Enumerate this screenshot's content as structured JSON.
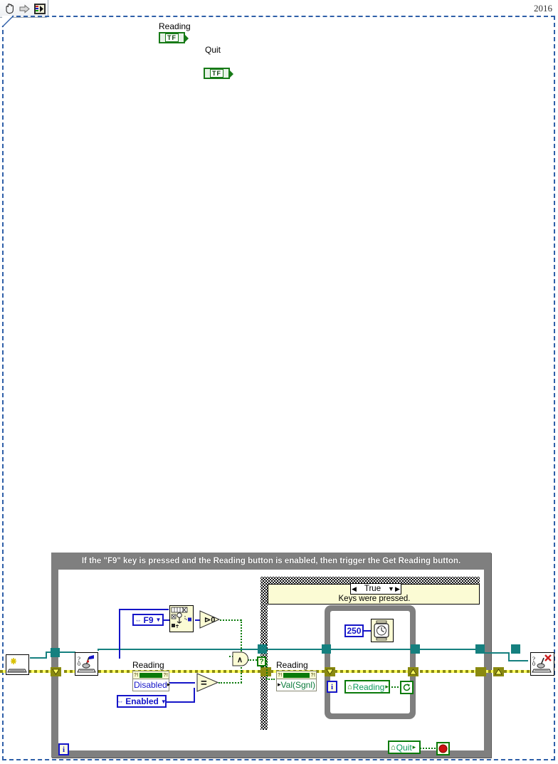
{
  "app": {
    "version_label": "2016"
  },
  "toolbar": {
    "buttons": [
      {
        "name": "hand-tool",
        "icon": "hand-icon",
        "label": "Hand tool"
      },
      {
        "name": "run-arrow",
        "icon": "arrow-right-icon",
        "label": "Run"
      },
      {
        "name": "connector-pane",
        "icon": "connector-pane-icon",
        "label": "Connector pane"
      }
    ]
  },
  "terminals": {
    "reading": {
      "label": "Reading",
      "value": "TF"
    },
    "quit": {
      "label": "Quit",
      "value": "TF"
    }
  },
  "while_loop": {
    "title": "If the \"F9\" key is pressed and the Reading button is enabled, then trigger the Get Reading button.",
    "iteration_label": "i"
  },
  "case_structure": {
    "selector_value": "True",
    "left_arrow": "◀",
    "right_arrow": "▶",
    "dropdown_arrow": "▼",
    "subtitle": "Keys were pressed."
  },
  "nodes": {
    "keyboard_init": {
      "name": "Initialize Keyboard",
      "icon": "keyboard-sparkle-icon"
    },
    "keyboard_acquire": {
      "name": "Acquire Input Data",
      "icon": "keyboard-joystick-icon"
    },
    "keyboard_close": {
      "name": "Close Input Device",
      "icon": "keyboard-joystick-close-icon"
    },
    "key_enum": {
      "value": "F9",
      "left_glyph": "⇔",
      "arrow": "▼"
    },
    "search_array": {
      "name": "Search 1D Array",
      "icon": "search-array-icon"
    },
    "greater_than_zero": {
      "label": "⊳0",
      "name": "Greater Than 0?"
    },
    "equals": {
      "label": "=",
      "name": "Equal?"
    },
    "and_gate": {
      "label": "∧",
      "name": "And"
    },
    "enabled_enum": {
      "value": "Enabled",
      "left_glyph": "⇔",
      "arrow": "▼"
    },
    "reading_disabled_prop": {
      "label": "Reading",
      "property": "Disabled",
      "arrow": "▸",
      "q_left": "?!",
      "q_right": "?!"
    },
    "reading_valsgnl_prop": {
      "label": "Reading",
      "property": "Val(Sgnl)",
      "arrow": "▸",
      "q_left": "?!",
      "q_right": "?!"
    },
    "wait_ms": {
      "constant": "250",
      "name": "Wait (ms)",
      "icon": "clock-icon"
    },
    "reading_ref": {
      "label": "Reading",
      "home_glyph": "⌂",
      "arrow": "▸"
    },
    "quit_ref": {
      "label": "Quit",
      "home_glyph": "⌂",
      "arrow": "▸"
    },
    "stop_sign": {
      "name": "stop-icon"
    },
    "loop_iteration": {
      "label": "i"
    },
    "timeout_node": {
      "name": "elapsed-timer-icon",
      "glyph": "⟳"
    },
    "case_selector_terminal": {
      "glyph": "?"
    }
  },
  "colors": {
    "wire_blue": "#1515c8",
    "wire_teal": "#15807f",
    "wire_error": "#8a8a10",
    "boolean_green": "#0a7a0a",
    "structure_gray": "#7f7f7f",
    "case_yellow": "#fbfbd4"
  }
}
